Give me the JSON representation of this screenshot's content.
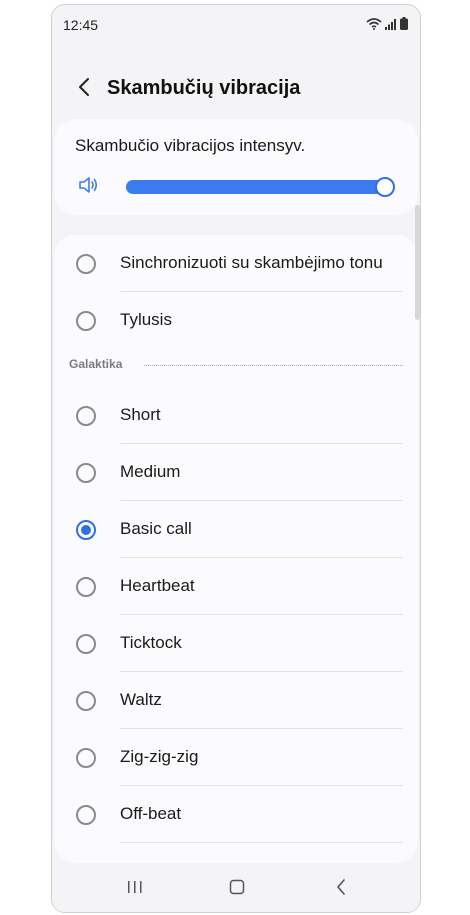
{
  "status_bar": {
    "time": "12:45",
    "icons": [
      "wifi-icon",
      "signal-icon",
      "battery-icon"
    ]
  },
  "header": {
    "back_icon": "chevron-left-icon",
    "title": "Skambučių vibracija"
  },
  "intensity": {
    "label": "Skambučio vibracijos intensyv.",
    "icon": "volume-icon",
    "level": 1.0,
    "accent_color": "#3a7bf0"
  },
  "options_top": [
    {
      "label": "Sinchronizuoti su skambėjimo tonu",
      "selected": false
    },
    {
      "label": "Tylusis",
      "selected": false
    }
  ],
  "section": {
    "label": "Galaktika"
  },
  "options_galaxy": [
    {
      "label": "Short",
      "selected": false
    },
    {
      "label": "Medium",
      "selected": false
    },
    {
      "label": "Basic call",
      "selected": true
    },
    {
      "label": "Heartbeat",
      "selected": false
    },
    {
      "label": "Ticktock",
      "selected": false
    },
    {
      "label": "Waltz",
      "selected": false
    },
    {
      "label": "Zig-zig-zig",
      "selected": false
    },
    {
      "label": "Off-beat",
      "selected": false
    }
  ],
  "nav_bar": {
    "icons": [
      "recent-apps-icon",
      "home-icon",
      "back-icon"
    ]
  }
}
